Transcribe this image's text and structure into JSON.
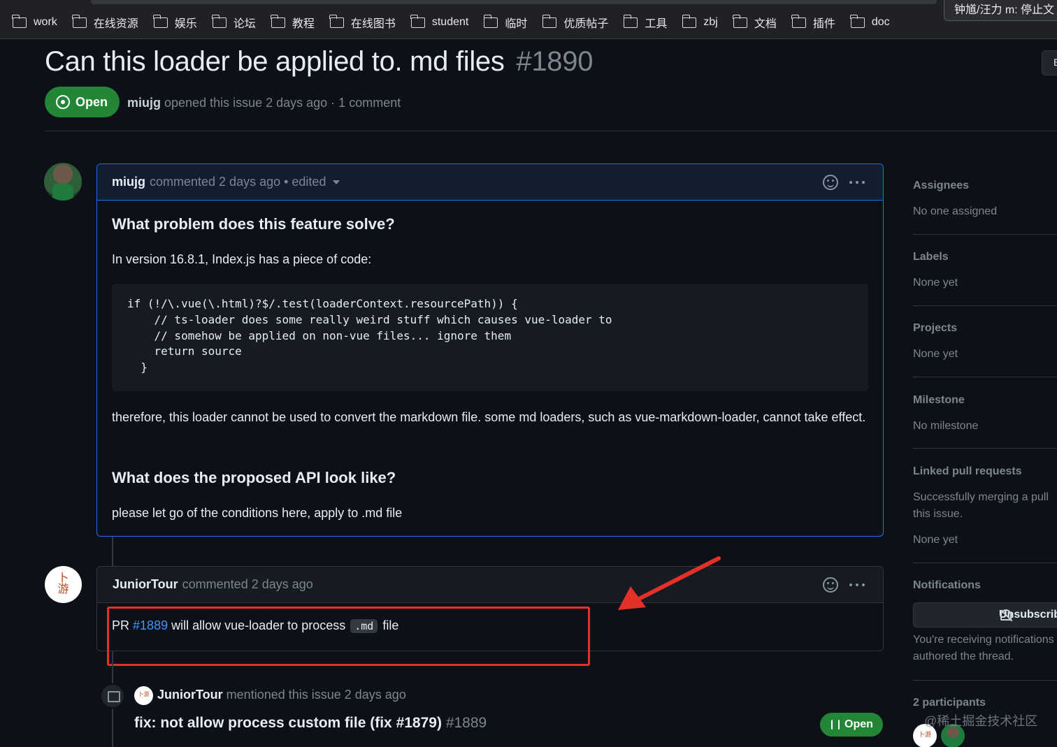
{
  "browser": {
    "bookmarks": [
      "work",
      "在线资源",
      "娱乐",
      "论坛",
      "教程",
      "在线图书",
      "student",
      "临时",
      "优质帖子",
      "工具",
      "zbj",
      "文档",
      "插件",
      "doc"
    ],
    "tooltip": "钟馗/汪力 m: 停止文"
  },
  "issue": {
    "title": "Can this loader be applied to. md files",
    "number": "#1890",
    "state": "Open",
    "edit_button": "E",
    "author": "miujg",
    "meta": "opened this issue 2 days ago · 1 comment"
  },
  "comments": [
    {
      "author": "miujg",
      "meta": "commented 2 days ago • edited",
      "h1": "What problem does this feature solve?",
      "p1": "In version 16.8.1, Index.js has a piece of code:",
      "code": "if (!/\\.vue(\\.html)?$/.test(loaderContext.resourcePath)) {\n    // ts-loader does some really weird stuff which causes vue-loader to\n    // somehow be applied on non-vue files... ignore them\n    return source\n  }",
      "p2": "therefore, this loader cannot be used to convert the markdown file. some md loaders, such as vue-markdown-loader, cannot take effect.",
      "h2": "What does the proposed API look like?",
      "p3": "please let go of the conditions here, apply to .md file"
    },
    {
      "author": "JuniorTour",
      "meta": "commented 2 days ago",
      "body_prefix": "PR",
      "body_link": "#1889",
      "body_mid": "will allow vue-loader to process",
      "body_code": ".md",
      "body_suffix": "file"
    }
  ],
  "event": {
    "author": "JuniorTour",
    "text": "mentioned this issue 2 days ago",
    "pr_title": "fix: not allow process custom file (fix #1879)",
    "pr_number": "#1889",
    "pr_state": "Open"
  },
  "sidebar": {
    "assignees_title": "Assignees",
    "assignees_value": "No one assigned",
    "labels_title": "Labels",
    "labels_value": "None yet",
    "projects_title": "Projects",
    "projects_value": "None yet",
    "milestone_title": "Milestone",
    "milestone_value": "No milestone",
    "linked_title": "Linked pull requests",
    "linked_desc1": "Successfully merging a pull",
    "linked_desc2": "this issue.",
    "linked_value": "None yet",
    "notifications_title": "Notifications",
    "unsubscribe_label": "Unsubscribe",
    "notif_desc1": "You're receiving notifications",
    "notif_desc2": "authored the thread.",
    "participants_title": "2 participants"
  },
  "watermark": "@稀土掘金技术社区",
  "colors": {
    "accent_blue": "#1f6feb",
    "open_green": "#238636",
    "annotation_red": "#e5302a",
    "bg": "#0d1117"
  }
}
